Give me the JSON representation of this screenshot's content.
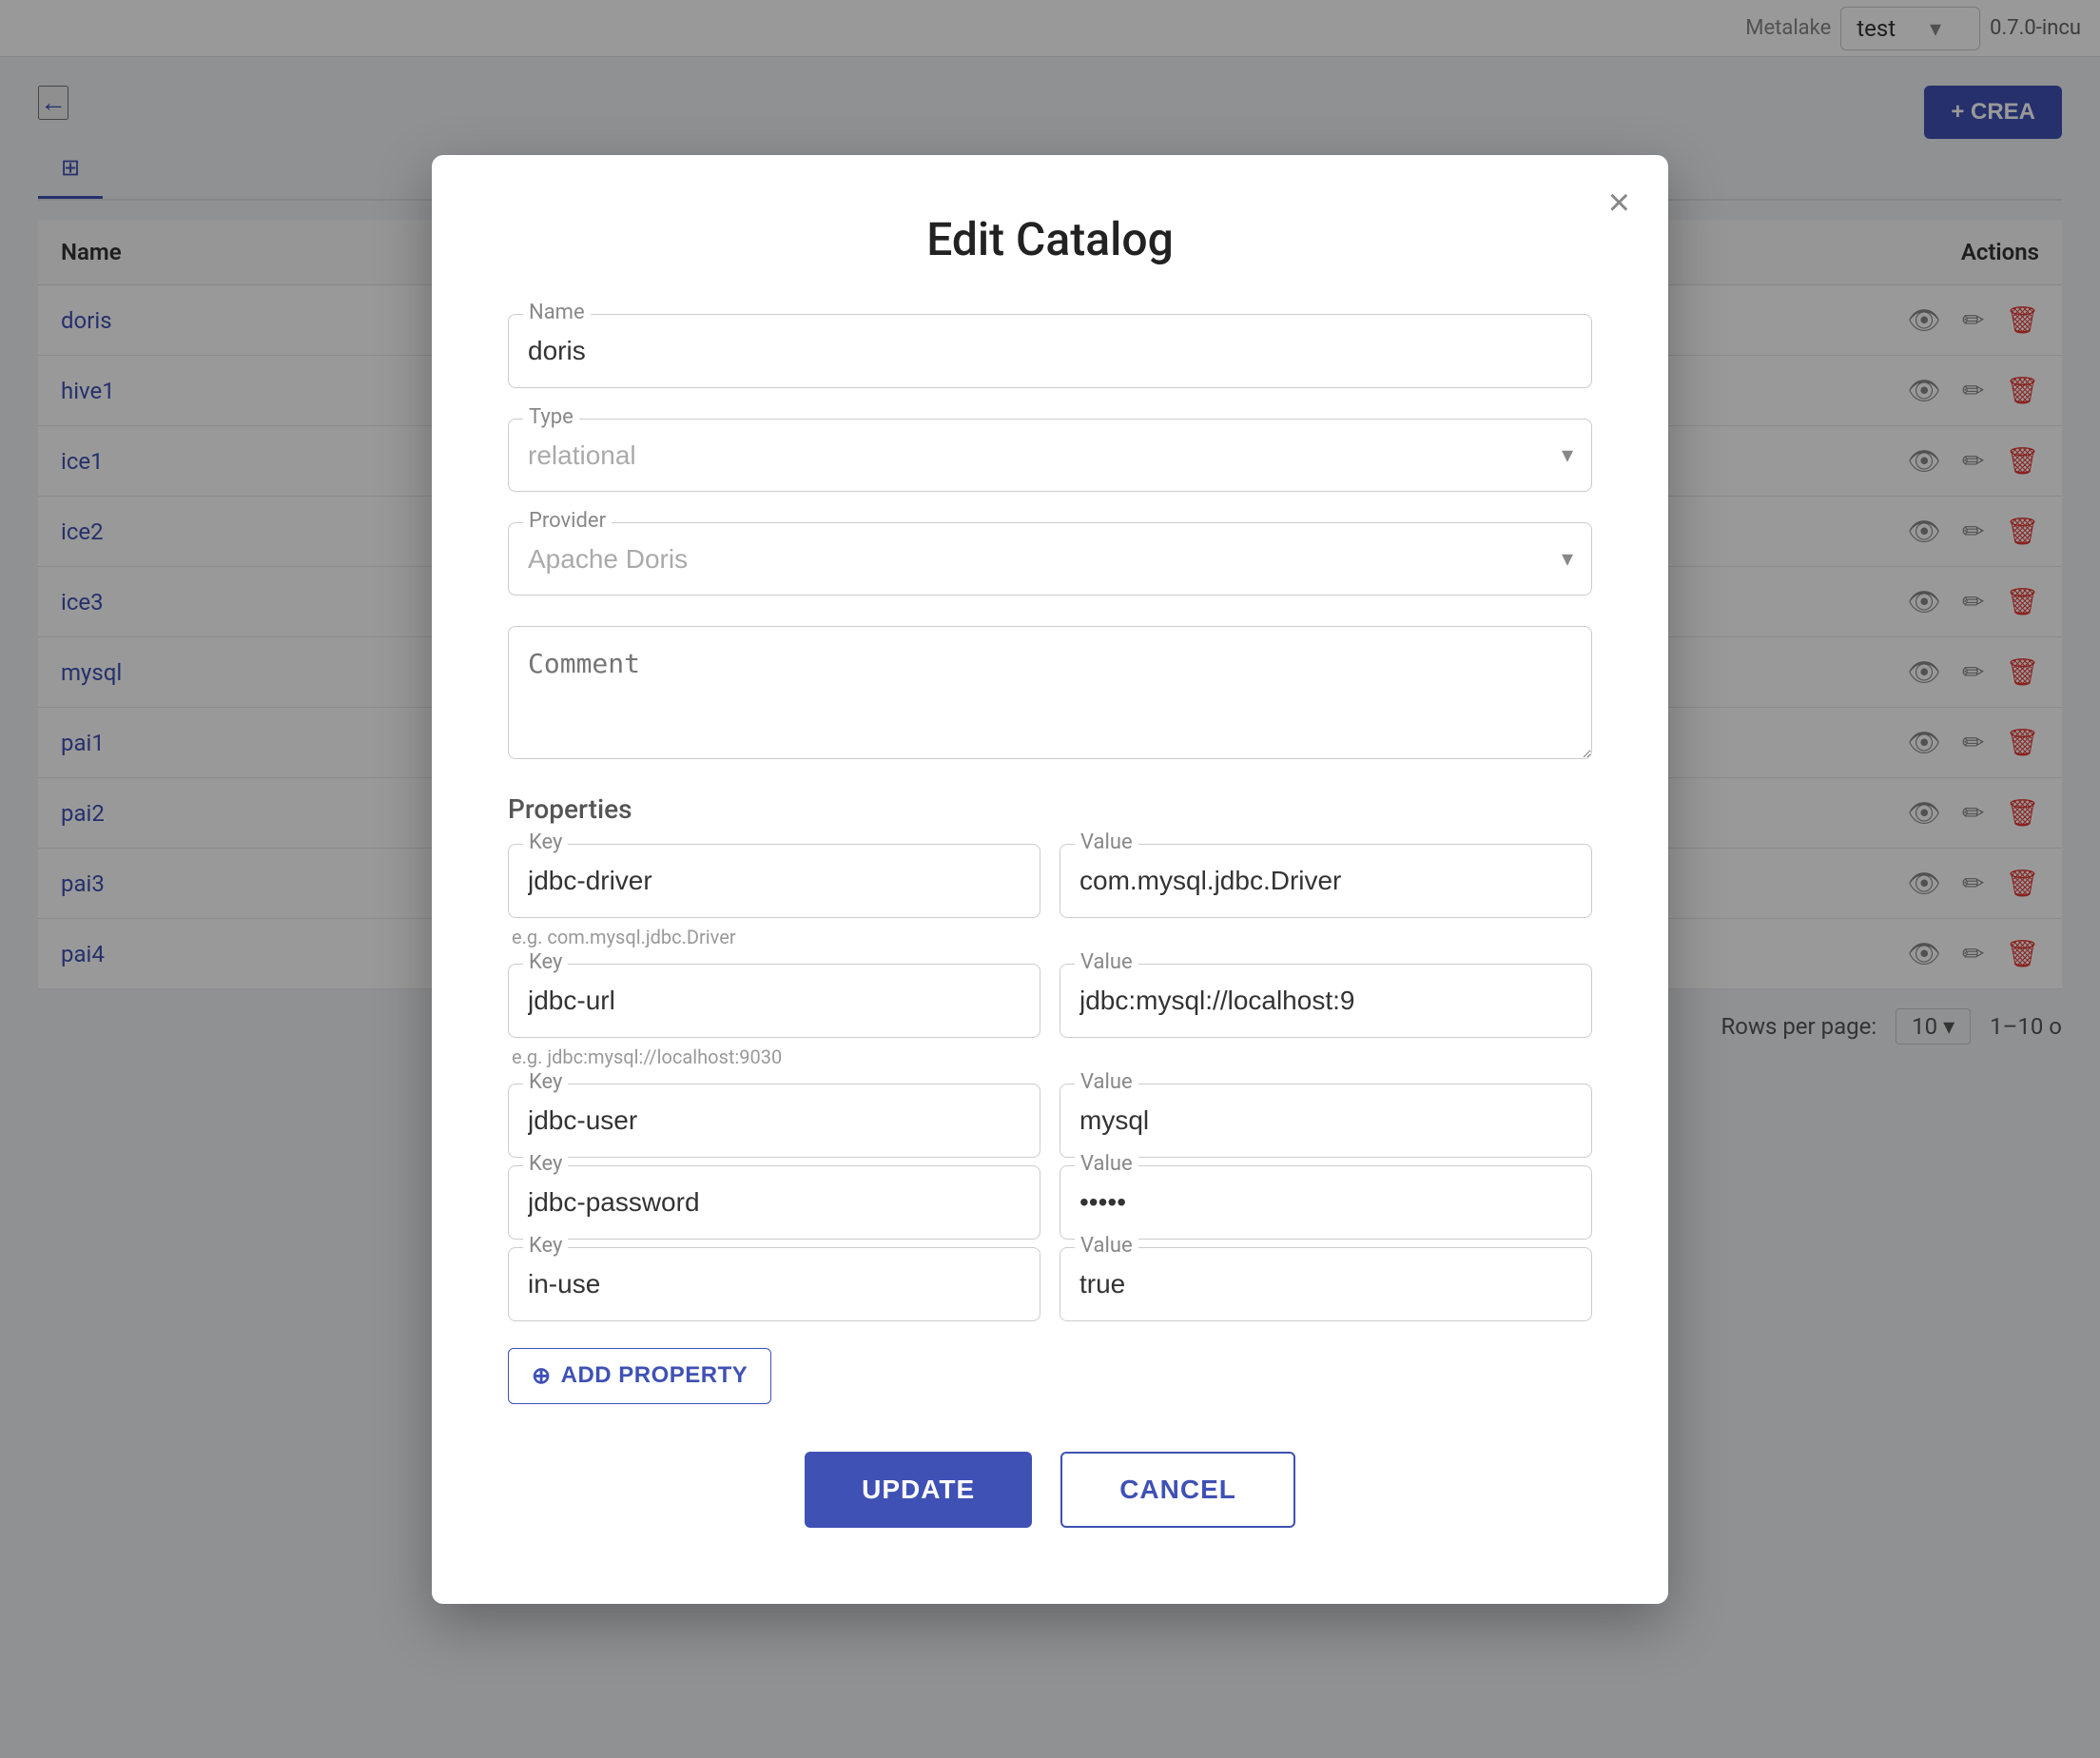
{
  "topbar": {
    "metalake_label": "Metalake",
    "metalake_value": "test",
    "version": "0.7.0-incu"
  },
  "page": {
    "back_icon": "←",
    "create_label": "+ CREA",
    "tab_label": "⊞"
  },
  "table": {
    "columns": [
      "Name",
      "Actions"
    ],
    "rows": [
      {
        "name": "doris"
      },
      {
        "name": "hive1"
      },
      {
        "name": "ice1"
      },
      {
        "name": "ice2"
      },
      {
        "name": "ice3"
      },
      {
        "name": "mysql"
      },
      {
        "name": "pai1"
      },
      {
        "name": "pai2"
      },
      {
        "name": "pai3"
      },
      {
        "name": "pai4"
      }
    ],
    "pagination": {
      "rows_per_page": "Rows per page:",
      "count": "10",
      "range": "1–10 o"
    }
  },
  "modal": {
    "title": "Edit Catalog",
    "close_icon": "×",
    "fields": {
      "name_label": "Name",
      "name_value": "doris",
      "type_label": "Type",
      "type_placeholder": "relational",
      "provider_label": "Provider",
      "provider_placeholder": "Apache Doris",
      "comment_label": "Comment",
      "comment_placeholder": "Comment"
    },
    "properties": {
      "section_title": "Properties",
      "items": [
        {
          "key_label": "Key",
          "key_value": "jdbc-driver",
          "value_label": "Value",
          "value_value": "com.mysql.jdbc.Driver",
          "hint": "e.g. com.mysql.jdbc.Driver"
        },
        {
          "key_label": "Key",
          "key_value": "jdbc-url",
          "value_label": "Value",
          "value_value": "jdbc:mysql://localhost:9",
          "hint": "e.g. jdbc:mysql://localhost:9030"
        },
        {
          "key_label": "Key",
          "key_value": "jdbc-user",
          "value_label": "Value",
          "value_value": "mysql",
          "hint": ""
        },
        {
          "key_label": "Key",
          "key_value": "jdbc-password",
          "value_label": "Value",
          "value_value": "•••••",
          "hint": ""
        },
        {
          "key_label": "Key",
          "key_value": "in-use",
          "value_label": "Value",
          "value_value": "true",
          "hint": ""
        }
      ],
      "add_button": "ADD PROPERTY"
    },
    "footer": {
      "update_label": "UPDATE",
      "cancel_label": "CANCEL"
    }
  },
  "icons": {
    "eye": "👁",
    "edit": "✏",
    "delete": "🗑",
    "plus_circle": "⊕",
    "chevron_down": "▾",
    "close": "×",
    "back": "←",
    "grid": "⊞"
  }
}
